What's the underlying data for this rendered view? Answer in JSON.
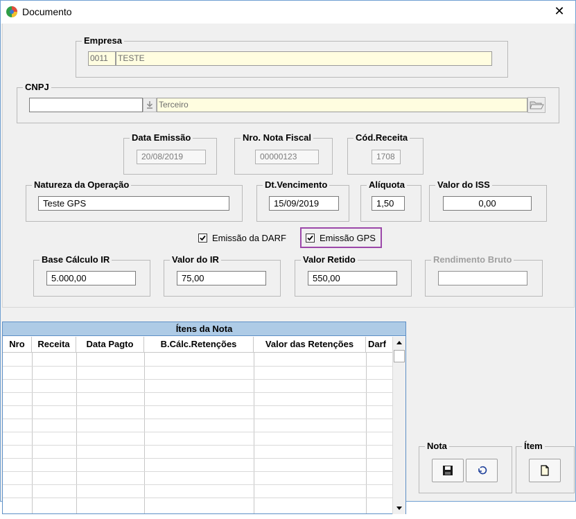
{
  "window": {
    "title": "Documento",
    "close_glyph": "✕"
  },
  "empresa": {
    "legend": "Empresa",
    "code": "0011",
    "name": "TESTE"
  },
  "cnpj": {
    "legend": "CNPJ",
    "value": "",
    "type": "Terceiro"
  },
  "data_emissao": {
    "legend": "Data Emissão",
    "value": "20/08/2019"
  },
  "nro_nota": {
    "legend": "Nro. Nota Fiscal",
    "value": "00000123"
  },
  "cod_receita": {
    "legend": "Cód.Receita",
    "value": "1708"
  },
  "natureza": {
    "legend": "Natureza da Operação",
    "value": "Teste GPS"
  },
  "dt_vencimento": {
    "legend": "Dt.Vencimento",
    "value": "15/09/2019"
  },
  "aliquota": {
    "legend": "Alíquota",
    "value": "1,50"
  },
  "valor_iss": {
    "legend": "Valor do ISS",
    "value": "0,00"
  },
  "checks": {
    "darf": {
      "label": "Emissão da DARF",
      "checked": true
    },
    "gps": {
      "label": "Emissão GPS",
      "checked": true
    }
  },
  "base_calculo": {
    "legend": "Base Cálculo IR",
    "value": "5.000,00"
  },
  "valor_ir": {
    "legend": "Valor do IR",
    "value": "75,00"
  },
  "valor_retido": {
    "legend": "Valor Retido",
    "value": "550,00"
  },
  "rendimento": {
    "legend": "Rendimento Bruto",
    "value": ""
  },
  "grid": {
    "title": "Ítens da Nota",
    "columns": [
      "Nro",
      "Receita",
      "Data Pagto",
      "B.Cálc.Retenções",
      "Valor das Retenções",
      "Darf"
    ],
    "rows": []
  },
  "nota_group": {
    "legend": "Nota"
  },
  "item_group": {
    "legend": "Ítem"
  },
  "colors": {
    "highlight": "#9b47a9",
    "grid_header": "#aecbe6",
    "readonly_yellow": "#fffde0"
  },
  "icons": [
    "app-globe-icon",
    "close-icon",
    "dropdown-arrow-icon",
    "folder-open-icon",
    "checkmark-icon",
    "save-disk-icon",
    "undo-icon",
    "new-document-icon",
    "scroll-up-icon",
    "scroll-down-icon"
  ]
}
